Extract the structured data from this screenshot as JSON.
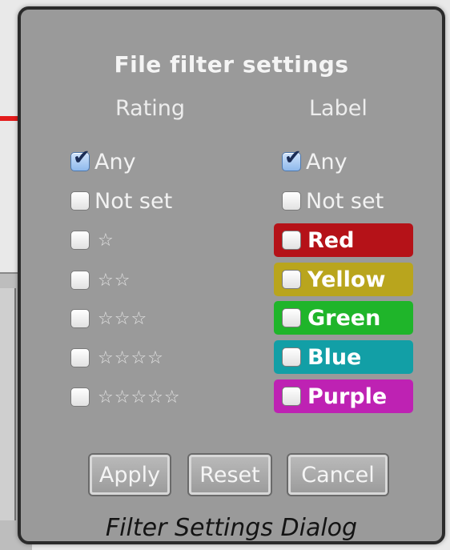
{
  "dialog": {
    "title": "File filter settings",
    "rating_header": "Rating",
    "label_header": "Label",
    "caption": "Filter Settings Dialog"
  },
  "rating": {
    "items": [
      {
        "text": "Any",
        "checked": true
      },
      {
        "text": "Not set",
        "checked": false
      },
      {
        "text": "☆",
        "checked": false
      },
      {
        "text": "☆☆",
        "checked": false
      },
      {
        "text": "☆☆☆",
        "checked": false
      },
      {
        "text": "☆☆☆☆",
        "checked": false
      },
      {
        "text": "☆☆☆☆☆",
        "checked": false
      }
    ]
  },
  "label": {
    "items": [
      {
        "text": "Any",
        "checked": true
      },
      {
        "text": "Not set",
        "checked": false
      },
      {
        "text": "Red",
        "checked": false,
        "color": "#b51218"
      },
      {
        "text": "Yellow",
        "checked": false,
        "color": "#b9a51d"
      },
      {
        "text": "Green",
        "checked": false,
        "color": "#1fb52a"
      },
      {
        "text": "Blue",
        "checked": false,
        "color": "#129fa6"
      },
      {
        "text": "Purple",
        "checked": false,
        "color": "#be22b3"
      }
    ]
  },
  "buttons": {
    "apply": "Apply",
    "reset": "Reset",
    "cancel": "Cancel"
  },
  "colors": {
    "dialog_bg": "#9a9a9a",
    "arrow": "#e31b1b"
  }
}
